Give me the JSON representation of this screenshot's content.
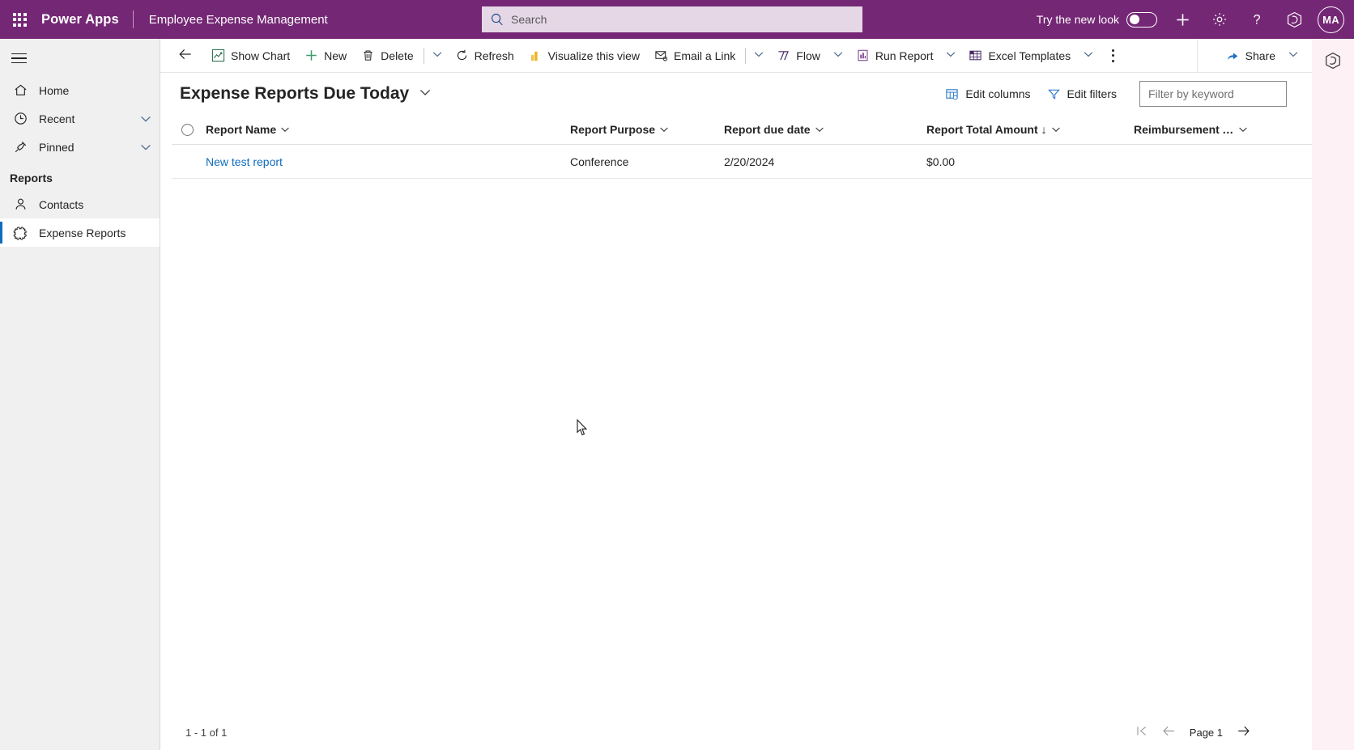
{
  "colors": {
    "brand_purple": "#742774",
    "search_field": "#e6d7e6",
    "link_blue": "#0f6cbd",
    "sidebar_bg": "#f0f0f0",
    "copilot_rail": "#fdf1f5",
    "text": "#242424"
  },
  "header": {
    "waffle_icon": "app-launcher-waffle-icon",
    "brand": "Power Apps",
    "app_name": "Employee Expense Management",
    "search": {
      "icon": "search-icon",
      "placeholder": "Search",
      "value": ""
    },
    "new_look": {
      "label": "Try the new look",
      "toggle_state": "off"
    },
    "add_icon": "plus-icon",
    "settings_icon": "gear-icon",
    "help_icon": "question-mark-icon",
    "copilot_icon": "copilot-icon",
    "avatar": {
      "initials": "MA",
      "name": "avatar"
    }
  },
  "sidebar": {
    "hamburger_icon": "hamburger-menu-icon",
    "items": [
      {
        "label": "Home",
        "icon": "home-icon",
        "expandable": false,
        "selected": false
      },
      {
        "label": "Recent",
        "icon": "clock-icon",
        "expandable": true,
        "selected": false
      },
      {
        "label": "Pinned",
        "icon": "pin-icon",
        "expandable": true,
        "selected": false
      }
    ],
    "group_title": "Reports",
    "group_items": [
      {
        "label": "Contacts",
        "icon": "person-icon",
        "selected": false
      },
      {
        "label": "Expense Reports",
        "icon": "puzzle-piece-icon",
        "selected": true
      }
    ]
  },
  "command_bar": {
    "back_icon": "arrow-left-icon",
    "items": [
      {
        "label": "Show Chart",
        "icon": "chart-icon",
        "has_chevron": false
      },
      {
        "label": "New",
        "icon": "plus-icon",
        "has_chevron": false
      },
      {
        "label": "Delete",
        "icon": "trash-icon",
        "has_chevron": true,
        "sep_before_chevron": true
      },
      {
        "label": "Refresh",
        "icon": "refresh-icon",
        "has_chevron": false
      },
      {
        "label": "Visualize this view",
        "icon": "powerbi-icon",
        "has_chevron": false
      },
      {
        "label": "Email a Link",
        "icon": "email-link-icon",
        "has_chevron": true,
        "sep_before_chevron": true
      },
      {
        "label": "Flow",
        "icon": "flow-icon",
        "has_chevron": true
      },
      {
        "label": "Run Report",
        "icon": "run-report-icon",
        "has_chevron": true
      },
      {
        "label": "Excel Templates",
        "icon": "excel-icon",
        "has_chevron": true
      }
    ],
    "overflow_icon": "more-vertical-icon",
    "share": {
      "label": "Share",
      "icon": "share-icon",
      "has_chevron": true
    }
  },
  "view": {
    "title": "Expense Reports Due Today",
    "title_chevron_icon": "chevron-down-icon",
    "edit_columns": {
      "label": "Edit columns",
      "icon": "edit-columns-icon"
    },
    "edit_filters": {
      "label": "Edit filters",
      "icon": "filter-icon"
    },
    "filter_input": {
      "placeholder": "Filter by keyword",
      "value": ""
    }
  },
  "grid": {
    "select_all_icon": "select-all-circle-icon",
    "columns": [
      {
        "label": "Report Name",
        "sort": "",
        "chevron": "chevron-down-icon"
      },
      {
        "label": "Report Purpose",
        "sort": "",
        "chevron": "chevron-down-icon"
      },
      {
        "label": "Report due date",
        "sort": "",
        "chevron": "chevron-down-icon"
      },
      {
        "label": "Report Total Amount",
        "sort": "↓",
        "chevron": "chevron-down-icon"
      },
      {
        "label": "Reimbursement Amount",
        "sort": "",
        "chevron": "chevron-down-icon"
      }
    ],
    "rows": [
      {
        "report_name": "New test report",
        "report_purpose": "Conference",
        "report_due_date": "2/20/2024",
        "report_total_amount": "$0.00",
        "reimbursement_amount": ""
      }
    ]
  },
  "footer": {
    "record_count": "1 - 1 of 1",
    "first_page_icon": "first-page-icon",
    "prev_page_icon": "arrow-left-icon",
    "page_label": "Page 1",
    "next_page_icon": "arrow-right-icon"
  }
}
